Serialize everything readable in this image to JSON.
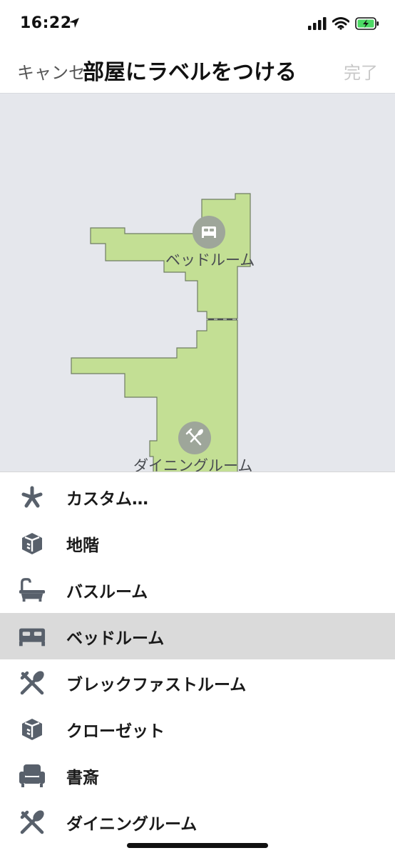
{
  "status": {
    "time": "16:22"
  },
  "nav": {
    "cancel": "キャンセル",
    "title": "部屋にラベルをつける",
    "done": "完了"
  },
  "map": {
    "rooms": [
      {
        "label": "ベッドルーム",
        "icon": "bed-icon"
      },
      {
        "label": "ダイニングルーム",
        "icon": "fork-spoon-icon"
      }
    ],
    "floor_color": "#c3df94",
    "background_color": "#e5e7ec"
  },
  "list": {
    "items": [
      {
        "label": "カスタム…",
        "icon": "asterisk-icon"
      },
      {
        "label": "地階",
        "icon": "box-icon"
      },
      {
        "label": "バスルーム",
        "icon": "bathtub-icon"
      },
      {
        "label": "ベッドルーム",
        "icon": "bed-icon",
        "selected": true
      },
      {
        "label": "ブレックファストルーム",
        "icon": "fork-spoon-icon"
      },
      {
        "label": "クローゼット",
        "icon": "box-icon"
      },
      {
        "label": "書斎",
        "icon": "armchair-icon"
      },
      {
        "label": "ダイニングルーム",
        "icon": "fork-spoon-icon"
      }
    ]
  },
  "colors": {
    "icon": "#58606b",
    "selected_row": "#dadada",
    "done_disabled": "#c8c8c8"
  }
}
